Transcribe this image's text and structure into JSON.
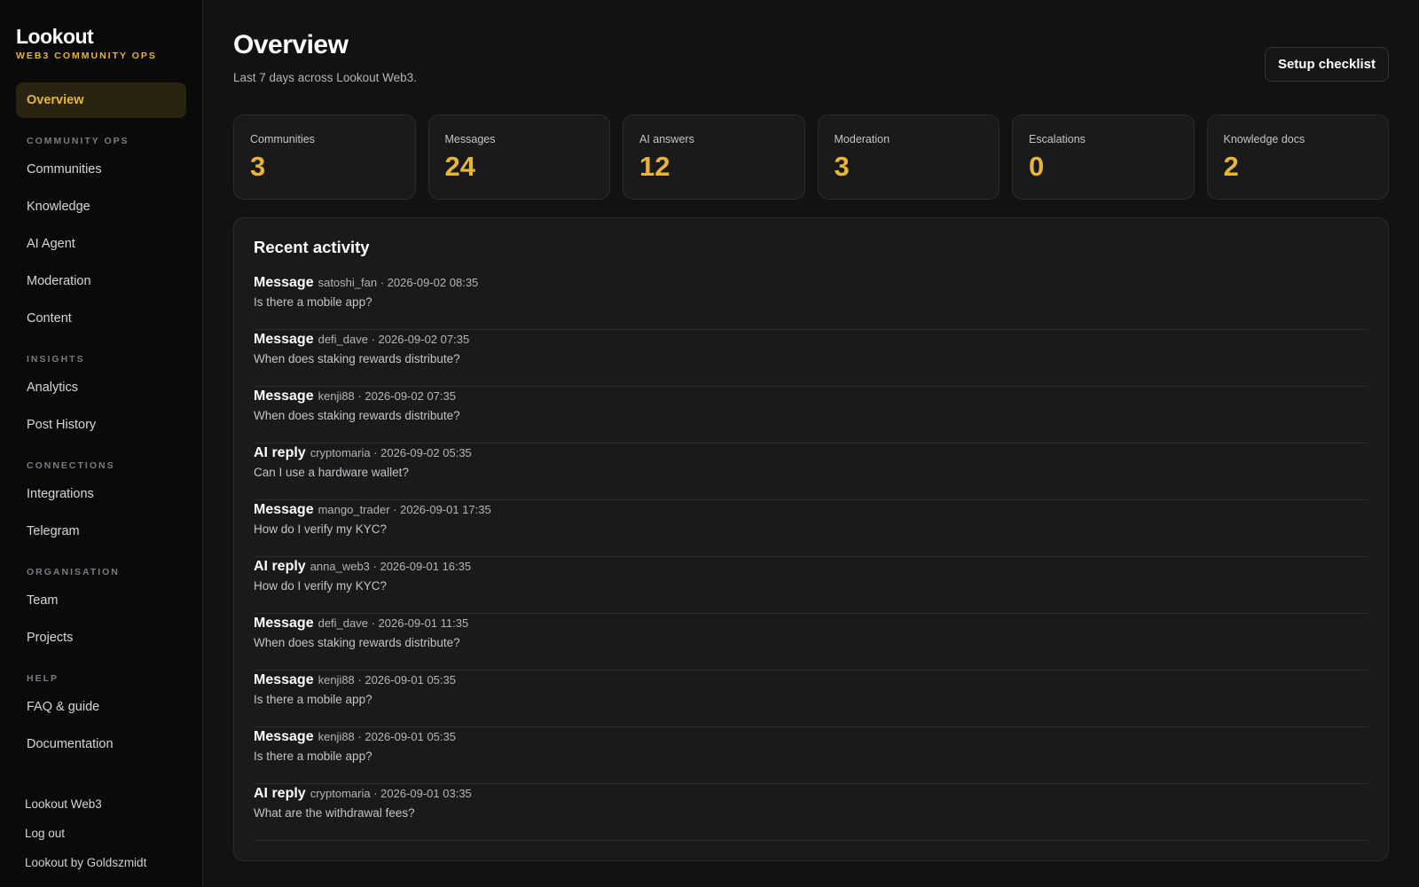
{
  "brand": {
    "name": "Lookout",
    "tagline": "WEB3 COMMUNITY OPS",
    "accent_color": "#e6b53a"
  },
  "sidebar": {
    "overview": "Overview",
    "sections": [
      {
        "title": "COMMUNITY OPS",
        "items": [
          "Communities",
          "Knowledge",
          "AI Agent",
          "Moderation",
          "Content"
        ]
      },
      {
        "title": "INSIGHTS",
        "items": [
          "Analytics",
          "Post History"
        ]
      },
      {
        "title": "CONNECTIONS",
        "items": [
          "Integrations",
          "Telegram"
        ]
      },
      {
        "title": "ORGANISATION",
        "items": [
          "Team",
          "Projects"
        ]
      },
      {
        "title": "HELP",
        "items": [
          "FAQ & guide",
          "Documentation"
        ]
      }
    ],
    "footer": {
      "workspace": "Lookout Web3",
      "logout": "Log out",
      "credit": "Lookout by Goldszmidt"
    }
  },
  "header": {
    "title": "Overview",
    "subtitle": "Last 7 days across Lookout Web3.",
    "setup_button": "Setup checklist"
  },
  "stats": [
    {
      "label": "Communities",
      "value": "3"
    },
    {
      "label": "Messages",
      "value": "24"
    },
    {
      "label": "AI answers",
      "value": "12"
    },
    {
      "label": "Moderation",
      "value": "3"
    },
    {
      "label": "Escalations",
      "value": "0"
    },
    {
      "label": "Knowledge docs",
      "value": "2"
    }
  ],
  "activity": {
    "title": "Recent activity",
    "items": [
      {
        "kind": "Message",
        "meta": "satoshi_fan · 2026-09-02 08:35",
        "text": "Is there a mobile app?"
      },
      {
        "kind": "Message",
        "meta": "defi_dave · 2026-09-02 07:35",
        "text": "When does staking rewards distribute?"
      },
      {
        "kind": "Message",
        "meta": "kenji88 · 2026-09-02 07:35",
        "text": "When does staking rewards distribute?"
      },
      {
        "kind": "AI reply",
        "meta": "cryptomaria · 2026-09-02 05:35",
        "text": "Can I use a hardware wallet?"
      },
      {
        "kind": "Message",
        "meta": "mango_trader · 2026-09-01 17:35",
        "text": "How do I verify my KYC?"
      },
      {
        "kind": "AI reply",
        "meta": "anna_web3 · 2026-09-01 16:35",
        "text": "How do I verify my KYC?"
      },
      {
        "kind": "Message",
        "meta": "defi_dave · 2026-09-01 11:35",
        "text": "When does staking rewards distribute?"
      },
      {
        "kind": "Message",
        "meta": "kenji88 · 2026-09-01 05:35",
        "text": "Is there a mobile app?"
      },
      {
        "kind": "Message",
        "meta": "kenji88 · 2026-09-01 05:35",
        "text": "Is there a mobile app?"
      },
      {
        "kind": "AI reply",
        "meta": "cryptomaria · 2026-09-01 03:35",
        "text": "What are the withdrawal fees?"
      }
    ]
  }
}
